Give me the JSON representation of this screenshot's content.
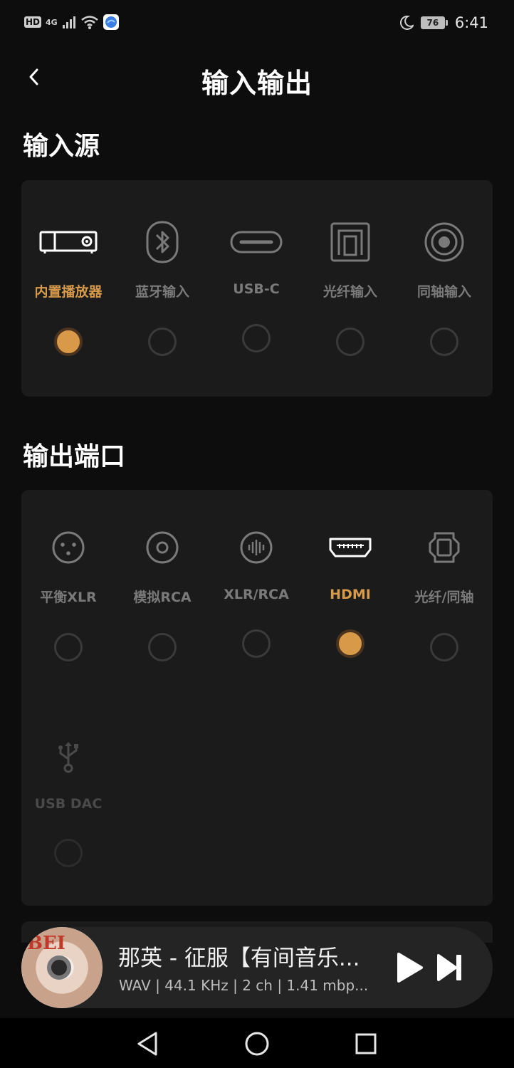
{
  "status_bar": {
    "hd": "HD",
    "network": "4G",
    "battery": "76",
    "time": "6:41"
  },
  "header": {
    "title": "输入输出"
  },
  "input_section": {
    "title": "输入源",
    "options": [
      {
        "label": "内置播放器",
        "icon": "projector-icon",
        "selected": true
      },
      {
        "label": "蓝牙输入",
        "icon": "bluetooth-icon",
        "selected": false
      },
      {
        "label": "USB-C",
        "icon": "usb-c-port-icon",
        "selected": false
      },
      {
        "label": "光纤输入",
        "icon": "optical-port-icon",
        "selected": false
      },
      {
        "label": "同轴输入",
        "icon": "coaxial-port-icon",
        "selected": false
      }
    ]
  },
  "output_section": {
    "title": "输出端口",
    "options": [
      {
        "label": "平衡XLR",
        "icon": "xlr-connector-icon",
        "selected": false
      },
      {
        "label": "模拟RCA",
        "icon": "rca-connector-icon",
        "selected": false
      },
      {
        "label": "XLR/RCA",
        "icon": "xlr-rca-icon",
        "selected": false
      },
      {
        "label": "HDMI",
        "icon": "hdmi-port-icon",
        "selected": true
      },
      {
        "label": "光纤/同轴",
        "icon": "optical-coaxial-icon",
        "selected": false
      },
      {
        "label": "USB DAC",
        "icon": "usb-icon",
        "selected": false,
        "disabled": true
      }
    ]
  },
  "player": {
    "title": "那英 - 征服【有间音乐...",
    "meta": "WAV | 44.1 KHz | 2 ch | 1.41 mbp...",
    "cover_mark": "BEI"
  },
  "colors": {
    "accent": "#d89a48",
    "background": "#0d0d0d",
    "panel": "#1b1b1b"
  }
}
